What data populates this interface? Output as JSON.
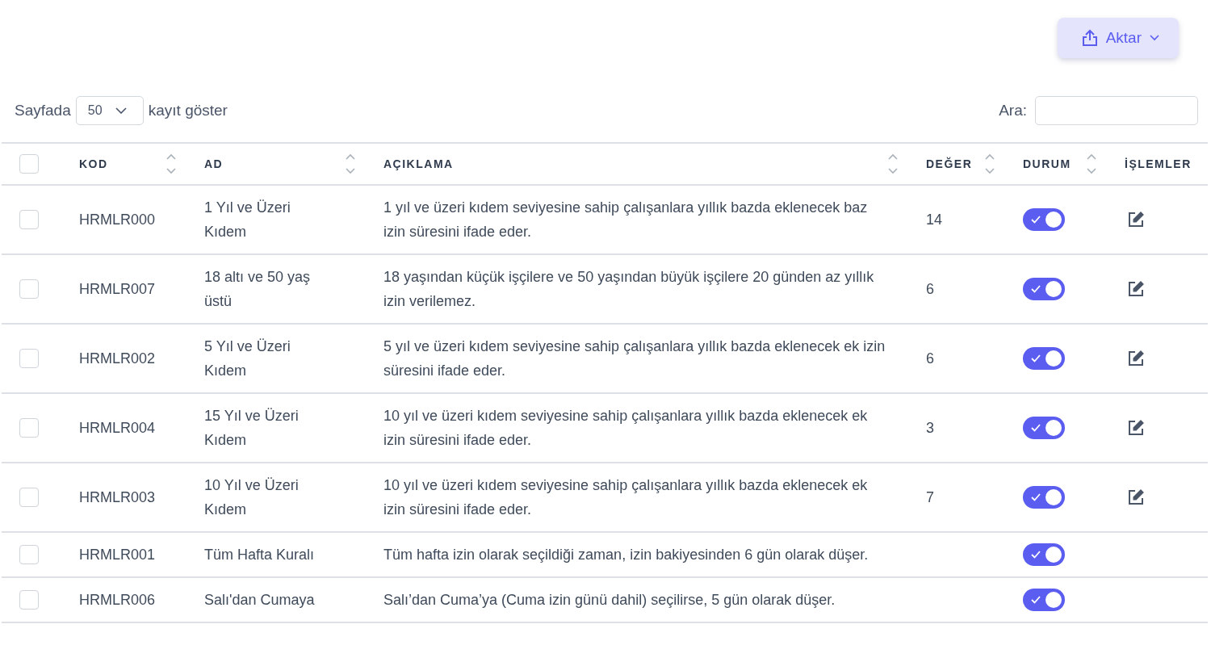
{
  "export_button": {
    "label": "Aktar"
  },
  "page_size": {
    "prefix": "Sayfada",
    "value": "50",
    "suffix": "kayıt göster"
  },
  "search": {
    "label": "Ara:"
  },
  "table": {
    "select_all": {
      "checked": false
    },
    "columns": [
      {
        "label": "KOD",
        "sortable": true
      },
      {
        "label": "AD",
        "sortable": true
      },
      {
        "label": "AÇIKLAMA",
        "sortable": true
      },
      {
        "label": "DEĞER",
        "sortable": true
      },
      {
        "label": "DURUM",
        "sortable": true
      },
      {
        "label": "İŞLEMLER",
        "sortable": false
      }
    ],
    "rows": [
      {
        "checked": false,
        "code": "HRMLR000",
        "name": "1 Yıl ve Üzeri Kıdem",
        "description": "1 yıl ve üzeri kıdem seviyesine sahip çalışanlara yıllık bazda eklenecek baz izin süresini ifade eder.",
        "value": "14",
        "on": true,
        "editable": true
      },
      {
        "checked": false,
        "code": "HRMLR007",
        "name": "18 altı ve 50 yaş üstü",
        "description": "18 yaşından küçük işçilere ve 50 yaşından büyük işçilere 20 günden az yıllık izin verilemez.",
        "value": "6",
        "on": true,
        "editable": true
      },
      {
        "checked": false,
        "code": "HRMLR002",
        "name": "5 Yıl ve Üzeri Kıdem",
        "description": "5 yıl ve üzeri kıdem seviyesine sahip çalışanlara yıllık bazda eklenecek ek izin süresini ifade eder.",
        "value": "6",
        "on": true,
        "editable": true
      },
      {
        "checked": false,
        "code": "HRMLR004",
        "name": "15 Yıl ve Üzeri Kıdem",
        "description": "10 yıl ve üzeri kıdem seviyesine sahip çalışanlara yıllık bazda eklenecek ek izin süresini ifade eder.",
        "value": "3",
        "on": true,
        "editable": true
      },
      {
        "checked": false,
        "code": "HRMLR003",
        "name": "10 Yıl ve Üzeri Kıdem",
        "description": "10 yıl ve üzeri kıdem seviyesine sahip çalışanlara yıllık bazda eklenecek ek izin süresini ifade eder.",
        "value": "7",
        "on": true,
        "editable": true
      },
      {
        "checked": false,
        "code": "HRMLR001",
        "name": "Tüm Hafta Kuralı",
        "description": "Tüm hafta izin olarak seçildiği zaman, izin bakiyesinden 6 gün olarak düşer.",
        "value": "",
        "on": true,
        "editable": false
      },
      {
        "checked": false,
        "code": "HRMLR006",
        "name": "Salı'dan Cumaya",
        "description": "Salı’dan Cuma’ya (Cuma izin günü dahil) seçilirse, 5 gün olarak düşer.",
        "value": "",
        "on": true,
        "editable": false
      }
    ]
  }
}
